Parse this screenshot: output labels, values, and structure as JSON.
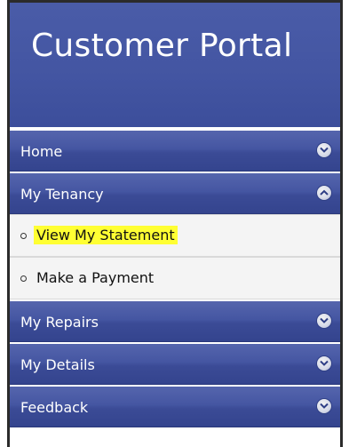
{
  "header": {
    "title": "Customer Portal"
  },
  "menu": {
    "home": "Home",
    "my_tenancy": "My Tenancy",
    "my_tenancy_sub": [
      "View My Statement",
      "Make a Payment"
    ],
    "my_repairs": "My Repairs",
    "my_details": "My Details",
    "feedback": "Feedback"
  },
  "colors": {
    "header_bg": "#4355a2",
    "menu_bg": "#4556a2",
    "highlight": "#ffff33"
  }
}
